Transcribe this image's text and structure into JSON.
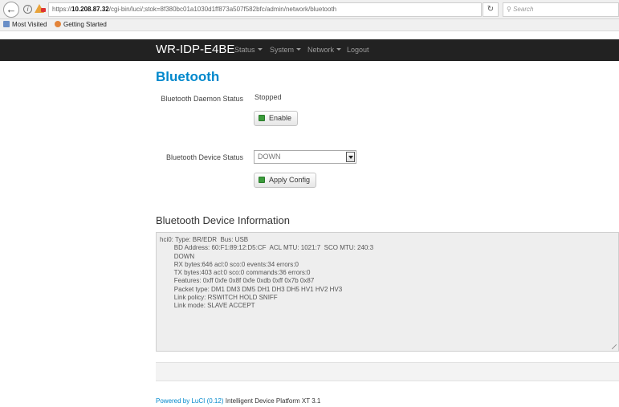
{
  "browser": {
    "url_prefix": "https://",
    "url_host": "10.208.87.32",
    "url_path": "/cgi-bin/luci/;stok=8f380bc01a1030d1ff873a507f582bfc/admin/network/bluetooth",
    "search_placeholder": "Search",
    "bookmarks": [
      "Most Visited",
      "Getting Started"
    ]
  },
  "navbar": {
    "brand": "WR-IDP-E4BE",
    "items": [
      {
        "label": "Status",
        "has_menu": true
      },
      {
        "label": "System",
        "has_menu": true
      },
      {
        "label": "Network",
        "has_menu": true
      },
      {
        "label": "Logout",
        "has_menu": false
      }
    ]
  },
  "page": {
    "title": "Bluetooth",
    "daemon_status_label": "Bluetooth Daemon Status",
    "daemon_status_value": "Stopped",
    "enable_button": "Enable",
    "device_status_label": "Bluetooth Device Status",
    "device_status_selected": "DOWN",
    "apply_button": "Apply Config",
    "info_title": "Bluetooth Device Information",
    "info_text": "hci0: Type: BR/EDR  Bus: USB\n        BD Address: 60:F1:89:12:D5:CF  ACL MTU: 1021:7  SCO MTU: 240:3\n        DOWN\n        RX bytes:646 acl:0 sco:0 events:34 errors:0\n        TX bytes:403 acl:0 sco:0 commands:36 errors:0\n        Features: 0xff 0xfe 0x8f 0xfe 0xdb 0xff 0x7b 0x87\n        Packet type: DM1 DM3 DM5 DH1 DH3 DH5 HV1 HV2 HV3\n        Link policy: RSWITCH HOLD SNIFF\n        Link mode: SLAVE ACCEPT"
  },
  "footer": {
    "link_text": "Powered by LuCI (0.12)",
    "platform_text": "Intelligent Device Platform XT 3.1"
  },
  "colors": {
    "navbar_bg": "#222222",
    "title_blue": "#0088cc",
    "button_icon_green": "#3c9c3c"
  }
}
